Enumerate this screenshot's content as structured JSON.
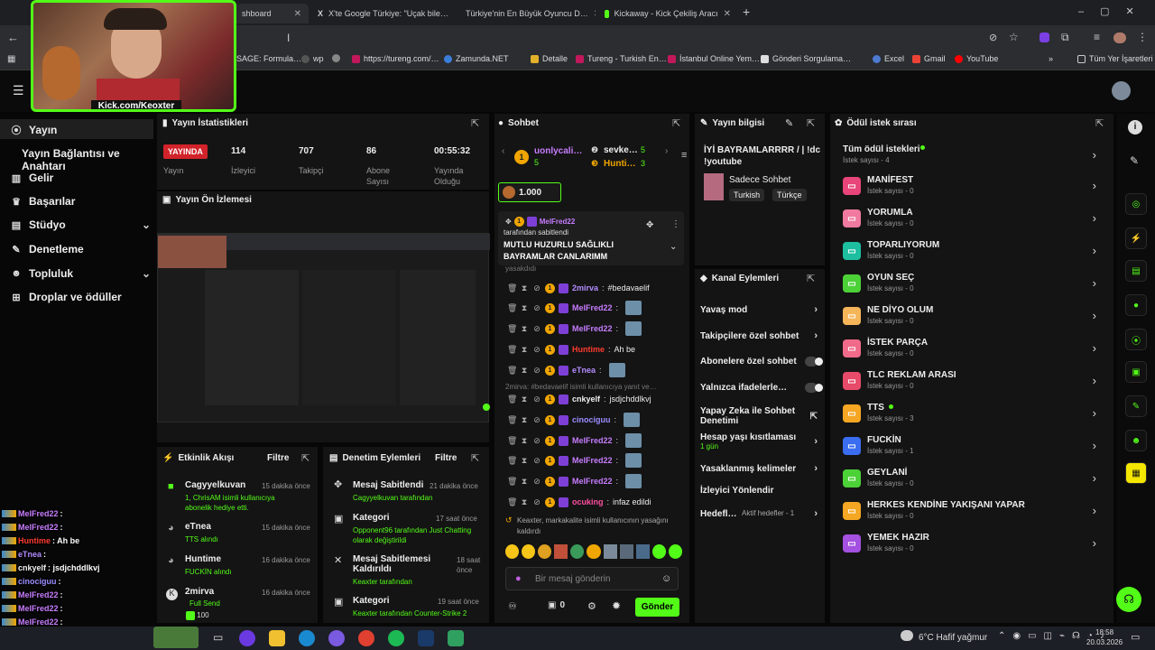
{
  "browser": {
    "tabs": [
      {
        "label": "shboard",
        "active": true
      },
      {
        "label": "X'te Google Türkiye: \"Uçak bile…"
      },
      {
        "label": "Türkiye'nin En Büyük Oyuncu D…"
      },
      {
        "label": "Kickaway - Kick Çekiliş Aracı"
      }
    ],
    "new_tab": "+",
    "bookmarks": [
      "SAGE: Formula…",
      "wp",
      "https://tureng.com/…",
      "Zamunda.NET",
      "Detalle",
      "Tureng - Turkish En…",
      "İstanbul Online Yem…",
      "Gönderi Sorgulama…",
      "Excel",
      "Gmail",
      "YouTube"
    ],
    "all_bookmarks": "Tüm Yer İşaretleri",
    "more": "»"
  },
  "webcam": {
    "caption": "Kick.com/Keoxter"
  },
  "sidebar": {
    "items": [
      {
        "label": "Yayın",
        "icon": "broadcast-icon"
      },
      {
        "label": "Yayın Bağlantısı ve Anahtarı",
        "icon": ""
      },
      {
        "label": "Gelir",
        "icon": "chart-icon"
      },
      {
        "label": "Başarılar",
        "icon": "trophy-icon"
      },
      {
        "label": "Stüdyo",
        "icon": "studio-icon"
      },
      {
        "label": "Denetleme",
        "icon": "wrench-icon"
      },
      {
        "label": "Topluluk",
        "icon": "users-icon"
      },
      {
        "label": "Droplar ve ödüller",
        "icon": "gift-icon"
      }
    ]
  },
  "stats": {
    "title": "Yayın İstatistikleri",
    "live_badge": "YAYINDA",
    "live_label": "Yayın",
    "viewers": {
      "value": "114",
      "label": "İzleyici"
    },
    "followers": {
      "value": "707",
      "label": "Takipçi"
    },
    "subs": {
      "value": "86",
      "label": "Abone Sayısı"
    },
    "uptime": {
      "value": "00:55:32",
      "label": "Yayında Olduğu"
    }
  },
  "preview": {
    "title": "Yayın Ön İzlemesi"
  },
  "activity": {
    "title": "Etkinlik Akışı",
    "filter": "Filtre",
    "items": [
      {
        "name": "Cagyyelkuvan",
        "time": "15 dakika önce",
        "detail": "1, ChrisAM isimli kullanıcıya abonelik hediye etti."
      },
      {
        "name": "eTnea",
        "time": "15 dakika önce",
        "detail": "TTS alındı"
      },
      {
        "name": "Huntime",
        "time": "16 dakika önce",
        "detail": "FUCKİN alındı"
      },
      {
        "name": "2mirva",
        "time": "16 dakika önce",
        "detail": "Full Send",
        "extra": "100"
      }
    ]
  },
  "mod": {
    "title": "Denetim Eylemleri",
    "filter": "Filtre",
    "items": [
      {
        "name": "Mesaj Sabitlendi",
        "time": "21 dakika önce",
        "detail": "Cagyyelkuvan tarafından"
      },
      {
        "name": "Kategori",
        "time": "17 saat önce",
        "detail": "Opponent96 tarafından Just Chatting olarak değiştirildi"
      },
      {
        "name": "Mesaj Sabitlemesi Kaldırıldı",
        "time": "18 saat önce",
        "detail": "Keaxter tarafından"
      },
      {
        "name": "Kategori",
        "time": "19 saat önce",
        "detail": "Keaxter tarafından Counter-Strike 2"
      }
    ]
  },
  "chat": {
    "title": "Sohbet",
    "top_gifters": [
      {
        "name": "uonlycali…",
        "count": "5"
      },
      {
        "name": "sevke…",
        "count": "5"
      },
      {
        "name": "Hunti…",
        "count": "3"
      }
    ],
    "goal": "1.000",
    "pinned": {
      "user": "MelFred22",
      "by": "tarafından sabitlendi",
      "text": "MUTLU HUZURLU SAĞLIKLI BAYRAMLAR CANLARIMM",
      "trail": "yasakdıdı"
    },
    "messages": [
      {
        "user": "2mirva",
        "color": "#b48cff",
        "text": "#bedavaelif"
      },
      {
        "user": "MelFred22",
        "color": "#c77dff",
        "text": ""
      },
      {
        "user": "MelFred22",
        "color": "#c77dff",
        "text": ""
      },
      {
        "user": "Huntime",
        "color": "#ff3b30",
        "text": "Ah be"
      },
      {
        "user": "eTnea",
        "color": "#b48cff",
        "text": ""
      },
      {
        "user": "cnkyelf",
        "color": "#f0f0f0",
        "text": "jsdjchddlkvj"
      },
      {
        "user": "cinociguu",
        "color": "#9b8cff",
        "text": ""
      },
      {
        "user": "MelFred22",
        "color": "#c77dff",
        "text": ""
      },
      {
        "user": "MelFred22",
        "color": "#c77dff",
        "text": ""
      },
      {
        "user": "MelFred22",
        "color": "#c77dff",
        "text": ""
      },
      {
        "user": "ocuking",
        "color": "#ff4fa0",
        "text": "infaz edildi"
      }
    ],
    "reply_note": "2mirva: #bedavaelif isimli kullanıcıya yanıt ve…",
    "ban_note": "Keaxter, markakalite isimli kullanıcının yasağını kaldırdı",
    "input_placeholder": "Bir mesaj gönderin",
    "send": "Gönder",
    "footer_count": "0"
  },
  "info": {
    "title": "Yayın bilgisi",
    "stream_title": "İYİ BAYRAMLARRRR / | !dc !youtube",
    "category": "Sadece Sohbet",
    "tags": [
      "Turkish",
      "Türkçe"
    ]
  },
  "channel_actions": {
    "title": "Kanal Eylemleri",
    "items": [
      {
        "label": "Yavaş mod",
        "kind": "chevron"
      },
      {
        "label": "Takipçilere özel sohbet",
        "kind": "chevron"
      },
      {
        "label": "Abonelere özel sohbet",
        "kind": "toggle"
      },
      {
        "label": "Yalnızca ifadelerle…",
        "kind": "toggle"
      },
      {
        "label": "Yapay Zeka ile Sohbet Denetimi",
        "kind": "external"
      },
      {
        "label": "Hesap yaşı kısıtlaması",
        "sub": "1 gün",
        "kind": "chevron"
      },
      {
        "label": "Yasaklanmış kelimeler",
        "kind": "chevron"
      },
      {
        "label": "İzleyici Yönlendir",
        "kind": "none"
      },
      {
        "label": "Hedefl…",
        "sub": "Aktif hedefler - 1",
        "kind": "chevron"
      }
    ]
  },
  "rewards": {
    "title": "Ödül istek sırası",
    "all": {
      "label": "Tüm ödül istekleri",
      "count": "İstek sayısı - 4"
    },
    "items": [
      {
        "label": "MANİFEST",
        "count": "İstek sayısı - 0",
        "color": "#e8457a"
      },
      {
        "label": "YORUMLA",
        "count": "İstek sayısı - 0",
        "color": "#f07aa0"
      },
      {
        "label": "TOPARLIYORUM",
        "count": "İstek sayısı - 0",
        "color": "#1dbfa0"
      },
      {
        "label": "OYUN SEÇ",
        "count": "İstek sayısı - 0",
        "color": "#4cd137"
      },
      {
        "label": "NE DİYO OLUM",
        "count": "İstek sayısı - 0",
        "color": "#f5b65a"
      },
      {
        "label": "İSTEK PARÇA",
        "count": "İstek sayısı - 0",
        "color": "#f06a8a"
      },
      {
        "label": "TLC REKLAM ARASI",
        "count": "İstek sayısı - 0",
        "color": "#e84a6a"
      },
      {
        "label": "TTS",
        "count": "İstek sayısı - 3",
        "color": "#f5a623"
      },
      {
        "label": "FUCKİN",
        "count": "İstek sayısı - 1",
        "color": "#3a6df0"
      },
      {
        "label": "GEYLANİ",
        "count": "İstek sayısı - 0",
        "color": "#4cd137"
      },
      {
        "label": "HERKES KENDİNE YAKIŞANI YAPAR",
        "count": "İstek sayısı - 0",
        "color": "#f5a623"
      },
      {
        "label": "YEMEK HAZIR",
        "count": "İstek sayısı - 0",
        "color": "#a450e0"
      }
    ]
  },
  "overlay_chat": [
    {
      "user": "MelFred22",
      "text": ":",
      "color": "#c77dff"
    },
    {
      "user": "MelFred22",
      "text": ":",
      "color": "#c77dff"
    },
    {
      "user": "Huntime",
      "text": ": Ah be",
      "color": "#ff3b30"
    },
    {
      "user": "eTnea",
      "text": ":",
      "color": "#b48cff"
    },
    {
      "user": "cnkyelf",
      "text": ": jsdjchddlkvj",
      "color": "#f0f0f0"
    },
    {
      "user": "cinociguu",
      "text": ":",
      "color": "#9b8cff"
    },
    {
      "user": "MelFred22",
      "text": ":",
      "color": "#c77dff"
    },
    {
      "user": "MelFred22",
      "text": ":",
      "color": "#c77dff"
    },
    {
      "user": "MelFred22",
      "text": ":",
      "color": "#c77dff"
    },
    {
      "user": "ocuking",
      "text": ": infaz edildi",
      "color": "#ff4fa0"
    }
  ],
  "taskbar": {
    "weather": "6°C  Hafif yağmur",
    "time": "18:58",
    "date": "20.03.2026"
  },
  "colors": {
    "accent": "#53fc18",
    "live": "#d2232a",
    "panel": "#141414"
  }
}
